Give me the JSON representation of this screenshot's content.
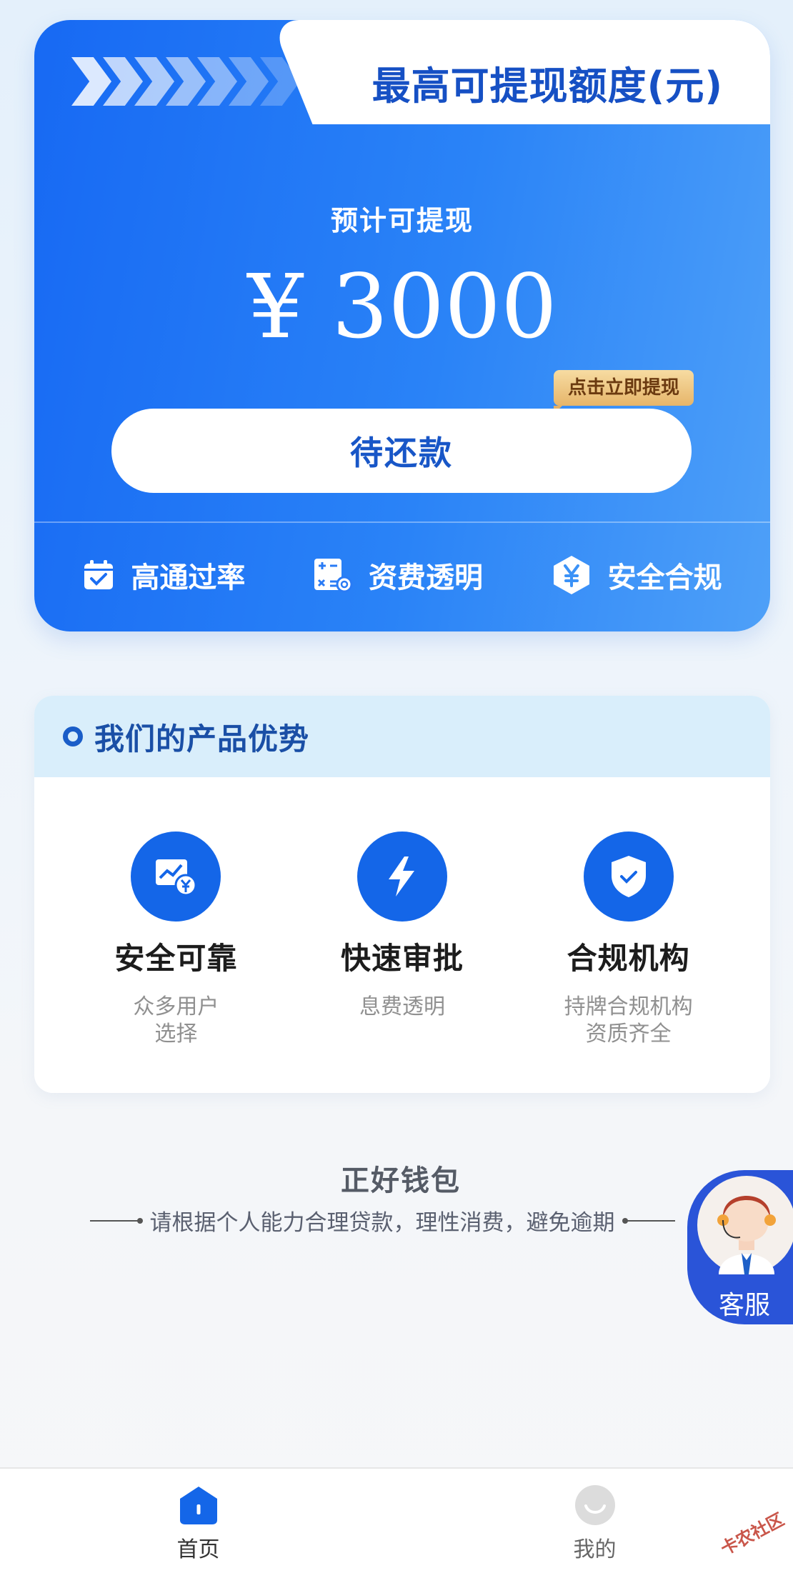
{
  "quota": {
    "title": "最高可提现额度(元)",
    "estimate_label": "预计可提现",
    "amount": "¥ 3000",
    "tip_badge": "点击立即提现",
    "repay_button": "待还款",
    "features": [
      {
        "icon": "calendar-check-icon",
        "label": "高通过率"
      },
      {
        "icon": "calculator-icon",
        "label": "资费透明"
      },
      {
        "icon": "yuan-shield-icon",
        "label": "安全合规"
      }
    ]
  },
  "advantages": {
    "title": "我们的产品优势",
    "items": [
      {
        "icon": "chart-yuan-icon",
        "name": "安全可靠",
        "desc_line1": "众多用户",
        "desc_line2": "选择"
      },
      {
        "icon": "lightning-icon",
        "name": "快速审批",
        "desc_line1": "息费透明",
        "desc_line2": ""
      },
      {
        "icon": "shield-check-icon",
        "name": "合规机构",
        "desc_line1": "持牌合规机构",
        "desc_line2": "资质齐全"
      }
    ]
  },
  "footer": {
    "brand": "正好钱包",
    "notice": "请根据个人能力合理贷款，理性消费，避免逾期"
  },
  "customer_service": {
    "label": "客服"
  },
  "nav": {
    "home": "首页",
    "mine": "我的"
  },
  "watermark": "卡农社区",
  "colors": {
    "primary": "#1769f3",
    "card_gradient_end": "#4ea0f8",
    "title_blue": "#1650c4",
    "badge_gold": "#e6b56a"
  }
}
